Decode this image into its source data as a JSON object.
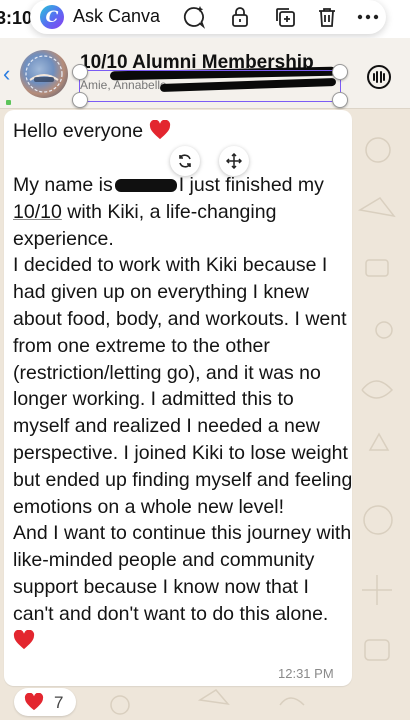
{
  "status_bar": {
    "time": "3:10"
  },
  "canva_toolbar": {
    "logo_letter": "C",
    "ask_label": "Ask Canva",
    "icons": [
      "ai-sparkle-comment-icon",
      "lock-icon",
      "duplicate-icon",
      "trash-icon",
      "more-icon"
    ]
  },
  "chat_header": {
    "title": "10/10 Alumni Membership",
    "members": "Amie, Annabelle"
  },
  "message": {
    "greeting": "Hello everyone",
    "line_1a": "My name is",
    "line_1b": "I just finished my",
    "line_2a": "10/10",
    "line_2b": " with Kiki, a life-changing",
    "paragraph_1_rest": "experience.",
    "paragraph_2": "I decided to work with Kiki because I had given up on everything I knew about food, body, and workouts. I went from one extreme to the other (restriction/letting go), and it was no longer working. I admitted this to myself and realized I needed a new perspective. I joined Kiki to lose weight but ended up finding myself and feeling emotions on a whole new level!",
    "paragraph_3": "And I want to continue this journey with like-minded people and community support because I know now that I can't and don't want to do this alone.",
    "time": "12:31 PM"
  },
  "reaction": {
    "emoji": "heart",
    "count": "7"
  },
  "colors": {
    "selection": "#7b5cf5",
    "heart": "#e3262f",
    "bubble": "#ffffff",
    "chat_background": "#eee6da",
    "canva_gradient_start": "#25c6d8",
    "canva_gradient_end": "#8b3ff0"
  }
}
